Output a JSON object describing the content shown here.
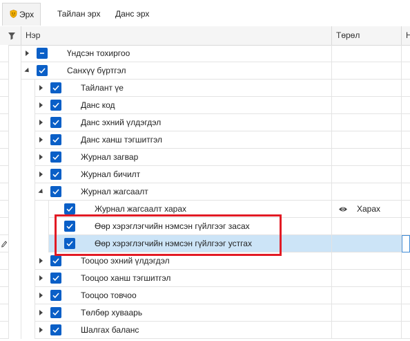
{
  "tabs": [
    {
      "label": "Эрх",
      "active": true
    },
    {
      "label": "Тайлан эрх",
      "active": false
    },
    {
      "label": "Данс эрх",
      "active": false
    }
  ],
  "columns": {
    "name": "Нэр",
    "type": "Төрөл",
    "next": "Н"
  },
  "rows": [
    {
      "label": "Үндсэн тохиргоо",
      "check": "partial",
      "expander": "right",
      "type": ""
    },
    {
      "label": "Санхүү бүртгэл",
      "check": "checked",
      "expander": "down",
      "type": ""
    },
    {
      "label": "Тайлант үе",
      "check": "checked",
      "expander": "right",
      "type": ""
    },
    {
      "label": "Данс код",
      "check": "checked",
      "expander": "right",
      "type": ""
    },
    {
      "label": "Данс эхний үлдэгдэл",
      "check": "checked",
      "expander": "right",
      "type": ""
    },
    {
      "label": "Данс ханш тэгшитгэл",
      "check": "checked",
      "expander": "right",
      "type": ""
    },
    {
      "label": "Журнал загвар",
      "check": "checked",
      "expander": "right",
      "type": ""
    },
    {
      "label": "Журнал бичилт",
      "check": "checked",
      "expander": "right",
      "type": ""
    },
    {
      "label": "Журнал жагсаалт",
      "check": "checked",
      "expander": "down",
      "type": ""
    },
    {
      "label": "Журнал жагсаалт харах",
      "check": "checked",
      "expander": "none",
      "type": "Харах",
      "type_icon": "eye-icon"
    },
    {
      "label": "Өөр хэрэглэгчийн нэмсэн гүйлгээг засах",
      "check": "checked",
      "expander": "none",
      "type": ""
    },
    {
      "label": "Өөр хэрэглэгчийн нэмсэн гүйлгээг устгах",
      "check": "checked",
      "expander": "none",
      "type": "",
      "selected": true
    },
    {
      "label": "Тооцоо эхний үлдэгдэл",
      "check": "checked",
      "expander": "right",
      "type": ""
    },
    {
      "label": "Тооцоо ханш тэгшитгэл",
      "check": "checked",
      "expander": "right",
      "type": ""
    },
    {
      "label": "Тооцоо товчоо",
      "check": "checked",
      "expander": "right",
      "type": ""
    },
    {
      "label": "Төлбөр хуваарь",
      "check": "checked",
      "expander": "right",
      "type": ""
    },
    {
      "label": "Шалгах баланс",
      "check": "checked",
      "expander": "right",
      "type": ""
    }
  ],
  "colors": {
    "checkbox": "#0a5fc7",
    "selection": "#cce4f7",
    "highlight": "#e21a24"
  }
}
